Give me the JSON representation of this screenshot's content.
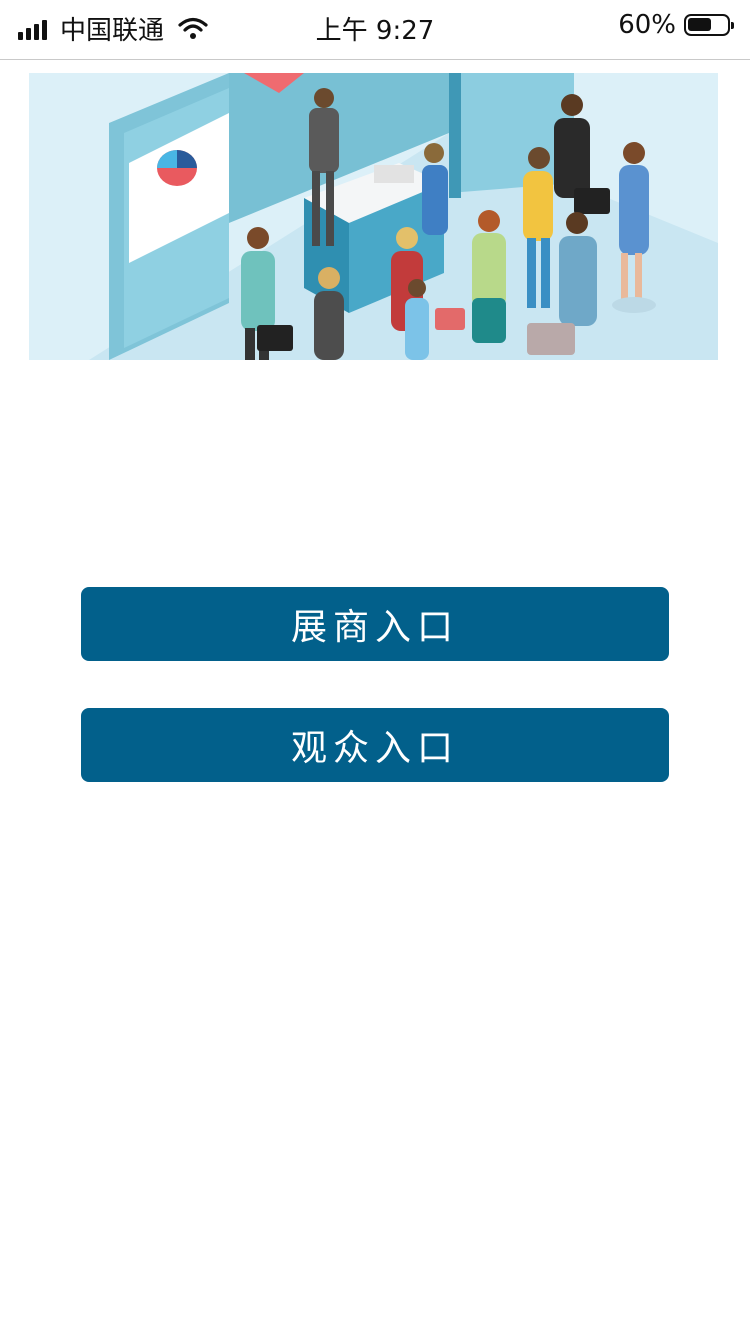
{
  "status_bar": {
    "carrier": "中国联通",
    "time": "上午 9:27",
    "battery_percent": "60%",
    "battery_level": 0.6,
    "icons": [
      "signal-icon",
      "wifi-icon",
      "battery-icon"
    ]
  },
  "banner": {
    "description": "exhibition-booth-illustration"
  },
  "buttons": {
    "exhibitor_label": "展商入口",
    "visitor_label": "观众入口"
  },
  "colors": {
    "button_bg": "#02608b",
    "button_text": "#ffffff",
    "banner_bg": "#dcf0f8"
  }
}
